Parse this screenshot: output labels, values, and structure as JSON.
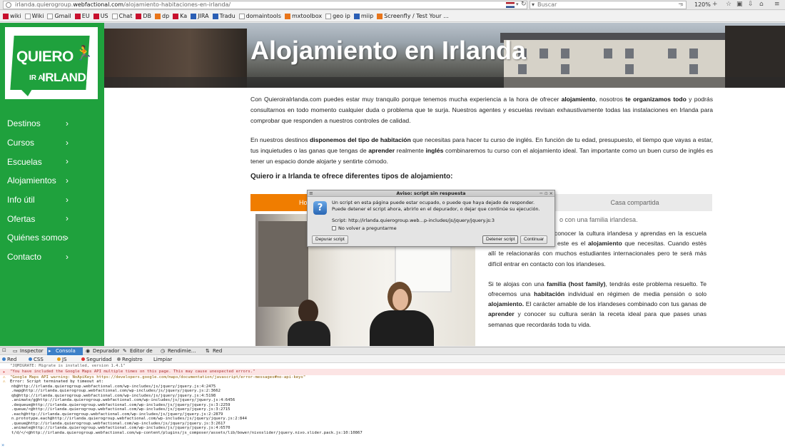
{
  "browser": {
    "url_prefix": "irlanda.quierogroup.",
    "url_host": "webfactional.com",
    "url_path": "/alojamiento-habitaciones-en-irlanda/",
    "search_placeholder": "Buscar",
    "zoom": "120%",
    "bookmarks": [
      "wiki",
      "Wiki",
      "Gmail",
      "EU",
      "US",
      "Chat",
      "DB",
      "dp",
      "Ka",
      "JIRA",
      "Tradu",
      "domaintools",
      "mxtoolbox",
      "geo ip",
      "miip",
      "Screenfly / Test Your ..."
    ],
    "icons": [
      "globe-icon",
      "dropdown-arrow-icon",
      "reload-icon",
      "search-icon",
      "star-icon",
      "clipboard-icon",
      "download-icon",
      "home-icon",
      "menu-icon"
    ]
  },
  "sidebar": {
    "logo": {
      "line1": "QUIERO",
      "line2a": "IR A",
      "line2b": "IRLANDA"
    },
    "items": [
      {
        "label": "Destinos",
        "chev": "›"
      },
      {
        "label": "Cursos",
        "chev": "›"
      },
      {
        "label": "Escuelas",
        "chev": "›"
      },
      {
        "label": "Alojamientos",
        "chev": "›"
      },
      {
        "label": "Info útil",
        "chev": "›"
      },
      {
        "label": "Ofertas",
        "chev": "›"
      },
      {
        "label": "Quiénes somos",
        "chev": "›"
      },
      {
        "label": "Contacto",
        "chev": "›"
      }
    ],
    "colors": {
      "green": "#1fa13d"
    }
  },
  "hero": {
    "title": "Alojamiento en Irlanda"
  },
  "content": {
    "p1": [
      {
        "t": "Con QuieroiraIrlanda.com puedes estar muy tranquilo porque tenemos mucha experiencia a la hora de ofrecer ",
        "b": false
      },
      {
        "t": "alojamiento",
        "b": true
      },
      {
        "t": ", nosotros ",
        "b": false
      },
      {
        "t": "te organizamos todo",
        "b": true
      },
      {
        "t": " y podrás consultarnos en todo momento cualquier duda o problema que te surja. Nuestros agentes y escuelas revisan exhaustivamente todas las instalaciones en Irlanda para comprobar que responden a nuestros controles de calidad.",
        "b": false
      }
    ],
    "p2": [
      {
        "t": "En nuestros destinos ",
        "b": false
      },
      {
        "t": "disponemos del tipo de habitación",
        "b": true
      },
      {
        "t": " que necesitas para hacer tu curso de inglés. En función de tu edad, presupuesto, el tiempo que vayas a estar, tus inquietudes o las ganas que tengas de ",
        "b": false
      },
      {
        "t": "aprender",
        "b": true
      },
      {
        "t": " realmente ",
        "b": false
      },
      {
        "t": "inglés",
        "b": true
      },
      {
        "t": " combinaremos tu curso con el alojamiento ideal. Tan importante como un buen curso de inglés es tener un espacio donde alojarte y sentirte cómodo.",
        "b": false
      }
    ],
    "subheading": "Quiero ir a Irlanda te ofrece diferentes tipos de alojamiento:",
    "tabs": {
      "home": "Home",
      "shared": "Casa compartida"
    },
    "family_caption": "o con una familia irlandesa.",
    "r1": [
      {
        "t": "glés en poco tiempo",
        "b": true
      },
      {
        "t": ", conocer la cultura irlandesa y aprendas en la escuela con nativos ",
        "b": false
      },
      {
        "t": "irlandeses",
        "b": true
      },
      {
        "t": ", este es el ",
        "b": false
      },
      {
        "t": "alojamiento",
        "b": true
      },
      {
        "t": " que necesitas. Cuando estés allí te relacionarás con muchos estudiantes internacionales pero te será más difícil entrar en contacto con los irlandeses.",
        "b": false
      }
    ],
    "r2": [
      {
        "t": "Si te alojas con una ",
        "b": false
      },
      {
        "t": "familia (host family)",
        "b": true
      },
      {
        "t": ", tendrás este problema resuelto. Te ofrecemos una ",
        "b": false
      },
      {
        "t": "habitación",
        "b": true
      },
      {
        "t": " individual en régimen de media pensión o solo ",
        "b": false
      },
      {
        "t": "alojamiento.",
        "b": true
      },
      {
        "t": " El carácter amable de los irlandeses combinado con tus ganas de ",
        "b": false
      },
      {
        "t": "aprender",
        "b": true
      },
      {
        "t": " y conocer su cultura serán la receta ideal para que pases unas semanas que recordarás toda tu vida.",
        "b": false
      }
    ]
  },
  "dialog": {
    "title": "Aviso: script sin respuesta",
    "message": "Un script en esta página puede estar ocupado, o puede que haya dejado de responder. Puede detener el script ahora, abrirlo en el depurador, o dejar que continúe su ejecución.",
    "script": "Script: http://irlanda.quierogroup.web…p-includes/js/jquery/jquery.js:3",
    "checkbox": "No volver a preguntarme",
    "btn_debug": "Depurar script",
    "btn_stop": "Detener script",
    "btn_continue": "Continuar"
  },
  "devtools": {
    "tabs": [
      "Inspector",
      "Consola",
      "Depurador",
      "Editor de ...",
      "Rendimie...",
      "Red"
    ],
    "active_tab": "Consola",
    "filters": [
      "Red",
      "CSS",
      "JS",
      "Seguridad",
      "Registro",
      "Limpiar"
    ],
    "filter_colors": [
      "#3c80c8",
      "#3c80c8",
      "#e6a017",
      "#d33",
      "#888",
      ""
    ],
    "logs": [
      "\"JQMIGRATE: Migrate is installed, version 1.4.1\"",
      "\"You have included the Google Maps API multiple times on this page. This may cause unexpected errors.\"",
      "\"Google Maps API warning: NoApiKeys https://developers.google.com/maps/documentation/javascript/error-messages#no-api-keys\"",
      "Error: Script terminated by timeout at:"
    ],
    "stack": [
      "nb@http://irlanda.quierogroup.webfactional.com/wp-includes/js/jquery/jquery.js:4:2475",
      ".map@http://irlanda.quierogroup.webfactional.com/wp-includes/js/jquery/jquery.js:2:3662",
      "qb@http://irlanda.quierogroup.webfactional.com/wp-includes/js/jquery/jquery.js:4:5198",
      ".animate/g@http://irlanda.quierogroup.webfactional.com/wp-includes/js/jquery/jquery.js:4:6456",
      ".dequeue@http://irlanda.quierogroup.webfactional.com/wp-includes/js/jquery/jquery.js:3:2259",
      ".queue/<@http://irlanda.quierogroup.webfactional.com/wp-includes/js/jquery/jquery.js:3:2715",
      ".each@http://irlanda.quierogroup.webfactional.com/wp-includes/js/jquery/jquery.js:2:2879",
      "n.prototype.each@http://irlanda.quierogroup.webfactional.com/wp-includes/js/jquery/jquery.js:2:844",
      ".queue@http://irlanda.quierogroup.webfactional.com/wp-includes/js/jquery/jquery.js:3:2617",
      ".animate@http://irlanda.quierogroup.webfactional.com/wp-includes/js/jquery/jquery.js:4:6570",
      "t/d/</<@http://irlanda.quierogroup.webfactional.com/wp-content/plugins/js_composer/assets/lib/bower/nivoslider/jquery.nivo.slider.pack.js:10:10867"
    ],
    "prompt": "»"
  }
}
